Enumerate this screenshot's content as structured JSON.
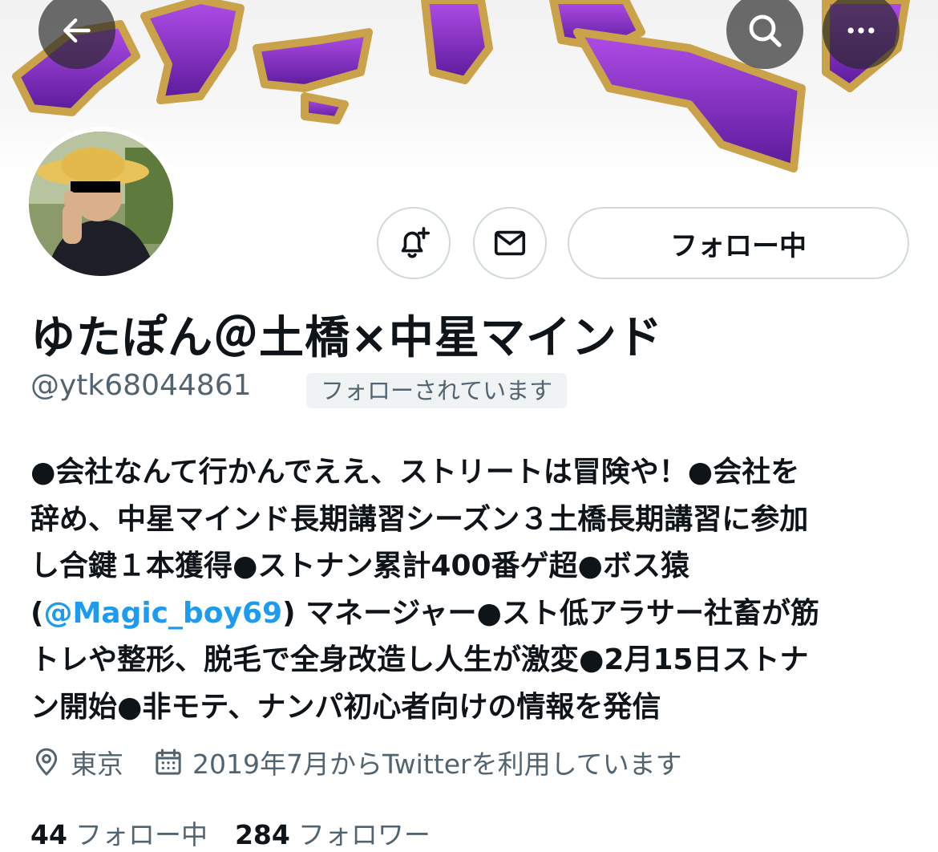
{
  "header": {
    "back_icon": "arrow-left-icon",
    "search_icon": "search-icon",
    "more_icon": "more-horizontal-icon"
  },
  "profile": {
    "display_name": "ゆたぽん＠土橋×中星マインド",
    "handle": "@ytk68044861",
    "follows_you_badge": "フォローされています",
    "actions": {
      "notify_icon": "bell-plus-icon",
      "message_icon": "mail-icon",
      "follow_label": "フォロー中"
    },
    "bio_lines": [
      "●会社なんて行かんでええ、ストリートは冒険や！●会社を",
      "辞め、中星マインド長期講習シーズン３土橋長期講習に参加",
      "し合鍵１本獲得●ストナン累計400番ゲ超●ボス猿"
    ],
    "bio_link_open": "(",
    "bio_mention": "@Magic_boy69",
    "bio_after_mention": ") マネージャー●スト低アラサー社畜が筋",
    "bio_lines_after": [
      "トレや整形、脱毛で全身改造し人生が激変●2月15日ストナ",
      "ン開始●非モテ、ナンパ初心者向けの情報を発信"
    ],
    "location": "東京",
    "joined": "2019年7月からTwitterを利用しています",
    "following_count": "44",
    "following_label": "フォロー中",
    "followers_count": "284",
    "followers_label": "フォロワー"
  },
  "colors": {
    "accent": "#1d9bf0",
    "secondary_text": "#536471",
    "border": "#cfd9de"
  }
}
